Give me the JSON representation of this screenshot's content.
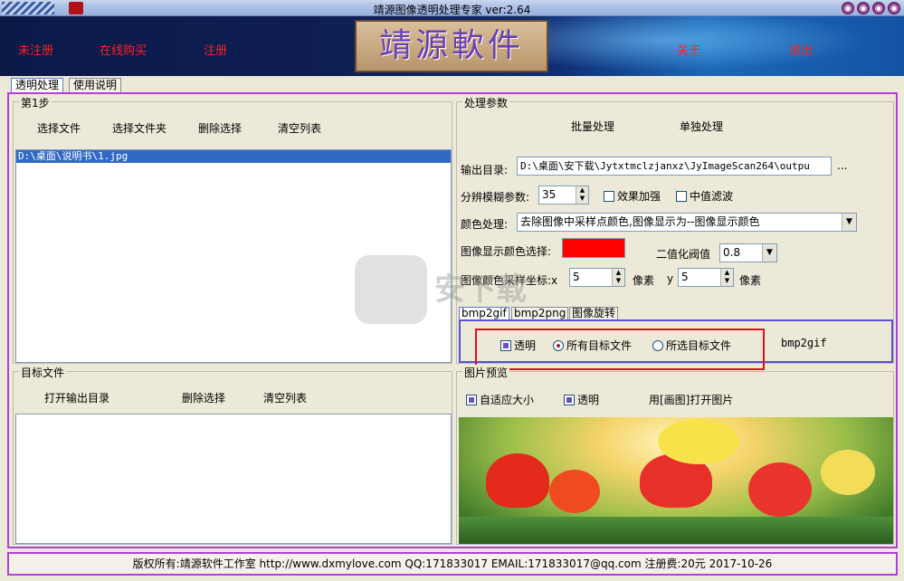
{
  "window": {
    "title": "靖源图像透明处理专家 ver:2.64",
    "buttons": [
      "◉",
      "◉",
      "◉",
      "◉"
    ]
  },
  "banner": {
    "links": [
      "未注册",
      "在线购买",
      "注册",
      "关于",
      "退出"
    ],
    "logo_text": "靖源軟件"
  },
  "main_tabs": [
    "透明处理",
    "使用说明"
  ],
  "step1": {
    "legend": "第1步",
    "buttons": [
      "选择文件",
      "选择文件夹",
      "删除选择",
      "清空列表"
    ],
    "files": [
      "D:\\桌面\\说明书\\1.jpg"
    ]
  },
  "target": {
    "legend": "目标文件",
    "buttons": [
      "打开输出目录",
      "删除选择",
      "清空列表"
    ]
  },
  "params": {
    "legend": "处理参数",
    "mode_buttons": [
      "批量处理",
      "单独处理"
    ],
    "output_label": "输出目录:",
    "output_value": "D:\\桌面\\安下载\\Jytxtmclzjanxz\\JyImageScan264\\outpu",
    "browse": "...",
    "blur_label": "分辨模糊参数:",
    "blur_value": "35",
    "enhance_label": "效果加强",
    "median_label": "中值滤波",
    "color_label": "颜色处理:",
    "color_value": "去除图像中采样点颜色,图像显示为--图像显示颜色",
    "display_color_label": "图像显示颜色选择:",
    "display_color": "#ff0000",
    "threshold_label": "二值化阀值",
    "threshold_value": "0.8",
    "sample_label": "图像颜色采样坐标:x",
    "sample_x": "5",
    "pixel_unit": "像素",
    "y_label": "y",
    "sample_y": "5",
    "pixel_unit_2": "像素",
    "subtabs": [
      "bmp2gif",
      "bmp2png",
      "图像旋转"
    ],
    "gif_options": {
      "transparent": "透明",
      "all_targets": "所有目标文件",
      "selected_targets": "所选目标文件",
      "title": "bmp2gif"
    }
  },
  "preview": {
    "legend": "图片预览",
    "auto_fit": "自适应大小",
    "transparent": "透明",
    "open_paint": "用[画图]打开图片"
  },
  "watermark_text": "安下载",
  "status": "版权所有:靖源软件工作室 http://www.dxmylove.com QQ:171833017 EMAIL:171833017@qq.com 注册费:20元 2017-10-26"
}
